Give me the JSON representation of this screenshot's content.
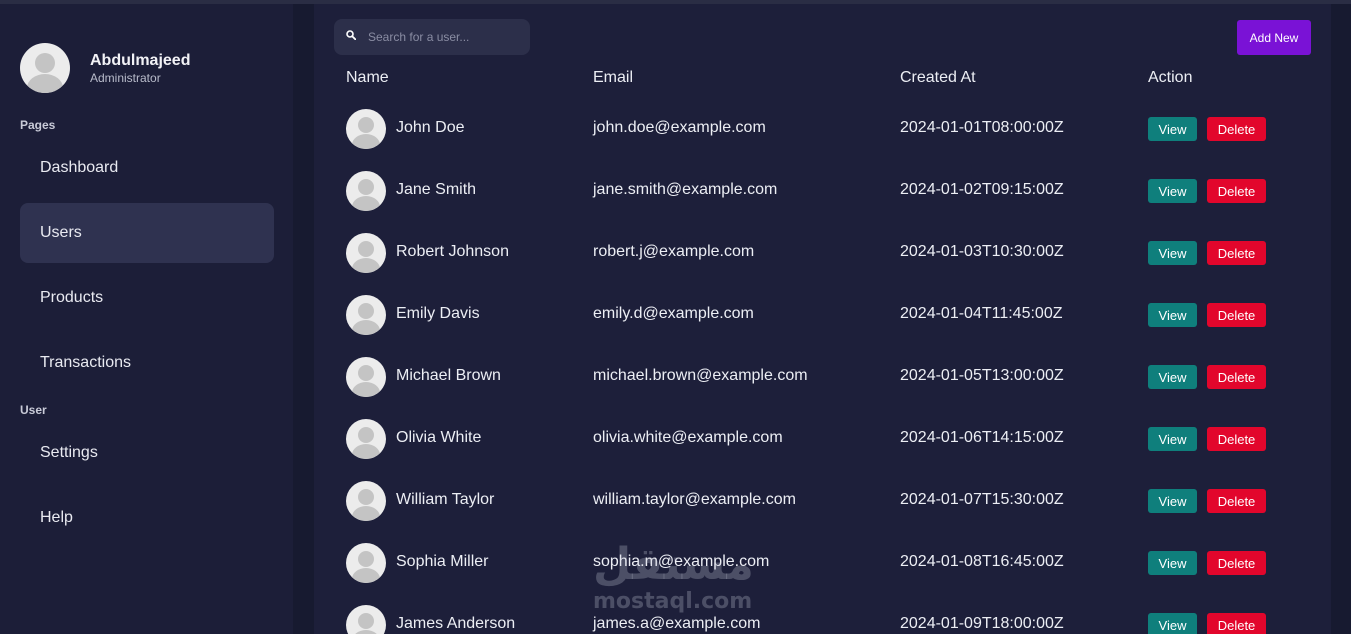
{
  "profile": {
    "name": "Abdulmajeed",
    "role": "Administrator"
  },
  "sidebar": {
    "sections": [
      {
        "label": "Pages"
      },
      {
        "label": "User"
      }
    ],
    "items": [
      {
        "label": "Dashboard",
        "active": false
      },
      {
        "label": "Users",
        "active": true
      },
      {
        "label": "Products",
        "active": false
      },
      {
        "label": "Transactions",
        "active": false
      },
      {
        "label": "Settings",
        "active": false
      },
      {
        "label": "Help",
        "active": false
      }
    ]
  },
  "search": {
    "placeholder": "Search for a user...",
    "value": ""
  },
  "toolbar": {
    "add_label": "Add New"
  },
  "table": {
    "headers": {
      "name": "Name",
      "email": "Email",
      "created": "Created At",
      "action": "Action"
    },
    "view_label": "View",
    "delete_label": "Delete",
    "rows": [
      {
        "name": "John Doe",
        "email": "john.doe@example.com",
        "created": "2024-01-01T08:00:00Z"
      },
      {
        "name": "Jane Smith",
        "email": "jane.smith@example.com",
        "created": "2024-01-02T09:15:00Z"
      },
      {
        "name": "Robert Johnson",
        "email": "robert.j@example.com",
        "created": "2024-01-03T10:30:00Z"
      },
      {
        "name": "Emily Davis",
        "email": "emily.d@example.com",
        "created": "2024-01-04T11:45:00Z"
      },
      {
        "name": "Michael Brown",
        "email": "michael.brown@example.com",
        "created": "2024-01-05T13:00:00Z"
      },
      {
        "name": "Olivia White",
        "email": "olivia.white@example.com",
        "created": "2024-01-06T14:15:00Z"
      },
      {
        "name": "William Taylor",
        "email": "william.taylor@example.com",
        "created": "2024-01-07T15:30:00Z"
      },
      {
        "name": "Sophia Miller",
        "email": "sophia.m@example.com",
        "created": "2024-01-08T16:45:00Z"
      },
      {
        "name": "James Anderson",
        "email": "james.a@example.com",
        "created": "2024-01-09T18:00:00Z"
      }
    ]
  },
  "watermark": {
    "arabic": "مستقل",
    "latin": "mostaql.com"
  },
  "colors": {
    "background": "#171a30",
    "sidebar": "#1c1e38",
    "panel": "#1d1f3a",
    "active_nav": "#2f3250",
    "add_button": "#7a12d6",
    "view_button": "#0f7f7c",
    "delete_button": "#e2062c"
  },
  "icons": {
    "search": "search-icon",
    "avatar": "user-avatar-icon"
  }
}
